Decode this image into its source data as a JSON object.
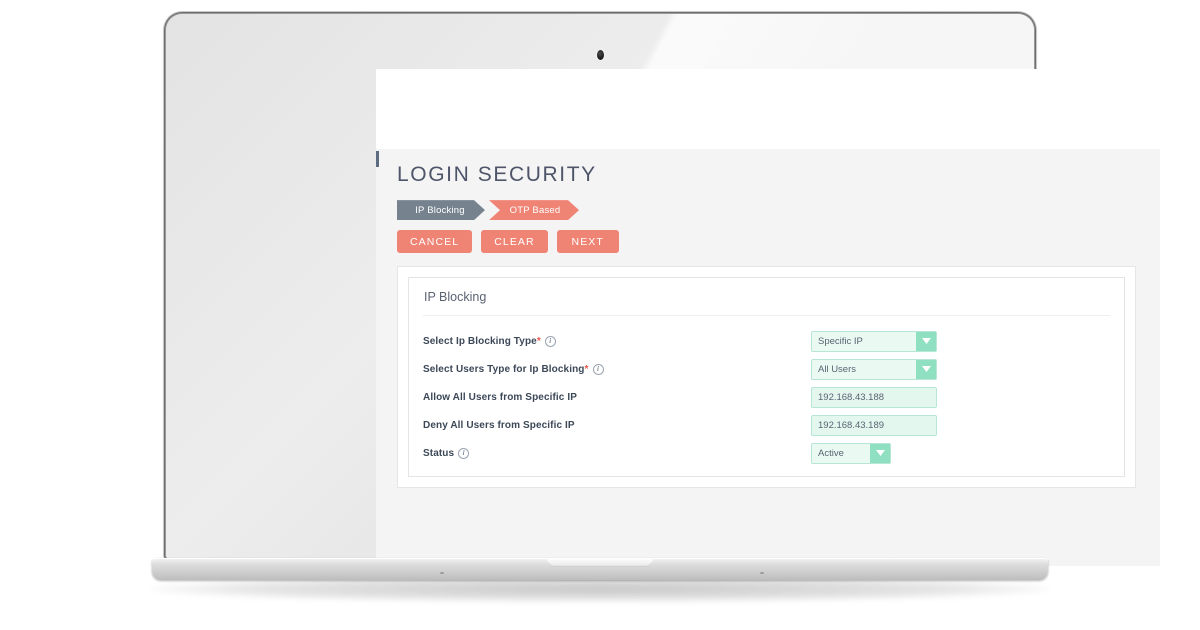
{
  "page": {
    "title": "LOGIN SECURITY"
  },
  "steps": [
    {
      "label": "IP Blocking",
      "state": "inactive",
      "color": "#76838f"
    },
    {
      "label": "OTP Based",
      "state": "active",
      "color": "#ef8475"
    }
  ],
  "actions": [
    {
      "label": "CANCEL",
      "name": "cancel-button"
    },
    {
      "label": "CLEAR",
      "name": "clear-button"
    },
    {
      "label": "NEXT",
      "name": "next-button"
    }
  ],
  "card": {
    "panel_title": "IP Blocking",
    "fields": [
      {
        "label": "Select Ip Blocking Type",
        "required": true,
        "has_info": true,
        "control": "select",
        "value": "Specific IP"
      },
      {
        "label": "Select Users Type for Ip Blocking",
        "required": true,
        "has_info": true,
        "control": "select",
        "value": "All Users"
      },
      {
        "label": "Allow All Users from Specific IP",
        "required": false,
        "has_info": false,
        "control": "text",
        "value": "192.168.43.188",
        "placeholder": ""
      },
      {
        "label": "Deny All Users from Specific IP",
        "required": false,
        "has_info": false,
        "control": "text",
        "value": "192.168.43.189",
        "placeholder": ""
      },
      {
        "label": "Status",
        "required": false,
        "has_info": true,
        "control": "select-narrow",
        "value": "Active"
      }
    ]
  },
  "theme": {
    "accent_salmon": "#ef8475",
    "step_grey": "#76838f",
    "field_mint": "#eafaf3",
    "field_mint_border": "#b8e6d6",
    "arrow_mint": "#8fe0c0",
    "title_color": "#4e5569",
    "page_bg": "#f4f4f4"
  }
}
